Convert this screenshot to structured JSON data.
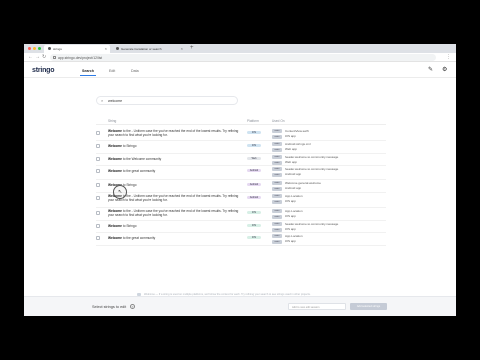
{
  "browser": {
    "tabs": [
      {
        "title": "strings",
        "active": true
      },
      {
        "title": "Generate translation or search",
        "active": false
      }
    ],
    "url": "app.stringo.dev/project/12/list"
  },
  "app": {
    "logo": "stringo",
    "nav": [
      {
        "label": "Search",
        "active": true
      },
      {
        "label": "Edit",
        "active": false
      },
      {
        "label": "Data",
        "active": false
      }
    ]
  },
  "search": {
    "value": "welcome"
  },
  "table": {
    "headers": {
      "string": "String",
      "platform": "Platform",
      "used_in": "Used On"
    },
    "rows": [
      {
        "bold": "Welcome",
        "text": " to the - Uniform case the you've reached the end of the lowest results. Try refining your search to find what you're looking for.",
        "platform": "iOS",
        "badge_color": "#cfe3f1",
        "files": [
          {
            "tag": "main",
            "name": "ContentView.swift"
          },
          {
            "tag": "main",
            "name": "iOS app"
          }
        ]
      },
      {
        "bold": "Welcome",
        "text": " to Stringo",
        "platform": "iOS",
        "badge_color": "#cfe3f1",
        "files": [
          {
            "tag": "main",
            "name": "Android.strings.xml"
          },
          {
            "tag": "main",
            "name": "Web app"
          }
        ]
      },
      {
        "bold": "Welcome",
        "text": " to the Welcome community",
        "platform": "Web",
        "badge_color": "#e3e6ea",
        "files": [
          {
            "tag": "main",
            "name": "header.welcome.to.community.message"
          },
          {
            "tag": "main",
            "name": "Web app"
          }
        ]
      },
      {
        "bold": "Welcome",
        "text": " to the great community",
        "platform": "Android",
        "badge_color": "#e6d9f1",
        "files": [
          {
            "tag": "main",
            "name": "header.welcome.to.community.message"
          },
          {
            "tag": "main",
            "name": "Android app"
          }
        ]
      },
      {
        "bold": "Welcome",
        "text": " to Stringo",
        "platform": "Android",
        "badge_color": "#e6d9f1",
        "files": [
          {
            "tag": "main",
            "name": "Welcome.general.welcome"
          },
          {
            "tag": "main",
            "name": "Android app"
          }
        ]
      },
      {
        "bold": "Welcome",
        "text": " to the - Uniform case the you've reached the end of the lowest results. Try refining your search to find what you're looking for.",
        "platform": "Android",
        "badge_color": "#e6d9f1",
        "files": [
          {
            "tag": "main",
            "name": "App.Location"
          },
          {
            "tag": "main",
            "name": "iOS app"
          }
        ]
      },
      {
        "bold": "Welcome",
        "text": " to the - Uniform case the you've reached the end of the lowest results. Try refining your search to find what you're looking for.",
        "platform": "iOS",
        "badge_color": "#d7efe6",
        "files": [
          {
            "tag": "main",
            "name": "App.Location"
          },
          {
            "tag": "main",
            "name": "iOS app"
          }
        ]
      },
      {
        "bold": "Welcome",
        "text": " to Stringo",
        "platform": "iOS",
        "badge_color": "#d7efe6",
        "files": [
          {
            "tag": "main",
            "name": "header.welcome.to.community.message"
          },
          {
            "tag": "main",
            "name": "iOS app"
          }
        ]
      },
      {
        "bold": "Welcome",
        "text": " to the great community",
        "platform": "iOS",
        "badge_color": "#d7efe6",
        "files": [
          {
            "tag": "main",
            "name": "App.Location"
          },
          {
            "tag": "main",
            "name": "iOS app"
          }
        ]
      }
    ]
  },
  "legend_note": "Welcome — If a string is used on multiple platforms, we'll show the context for each. Try refining your search to see strings used in other projects.",
  "footer": {
    "label": "Select strings to edit",
    "select_placeholder": "Add to new edit session",
    "button": "Add selected strings"
  },
  "colors": {
    "accent": "#2d7be5",
    "logo": "#1e2a4a"
  }
}
